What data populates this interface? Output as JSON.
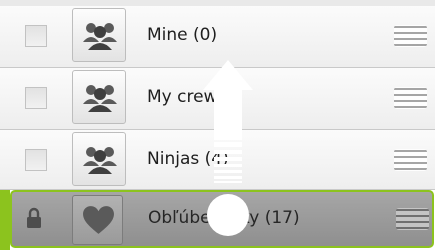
{
  "groups": [
    {
      "label": "Mine (0)"
    },
    {
      "label": "My crew"
    },
    {
      "label": "Ninjas (4)"
    }
  ],
  "favorites": {
    "label": "Obľúbe  ložky (17)"
  },
  "icons": {
    "group": "people-group-icon",
    "heart": "heart-icon",
    "lock": "lock-icon",
    "grip": "drag-handle-icon",
    "gesture": "swipe-up-arrow-icon"
  },
  "colors": {
    "accent": "#8cc31e"
  }
}
